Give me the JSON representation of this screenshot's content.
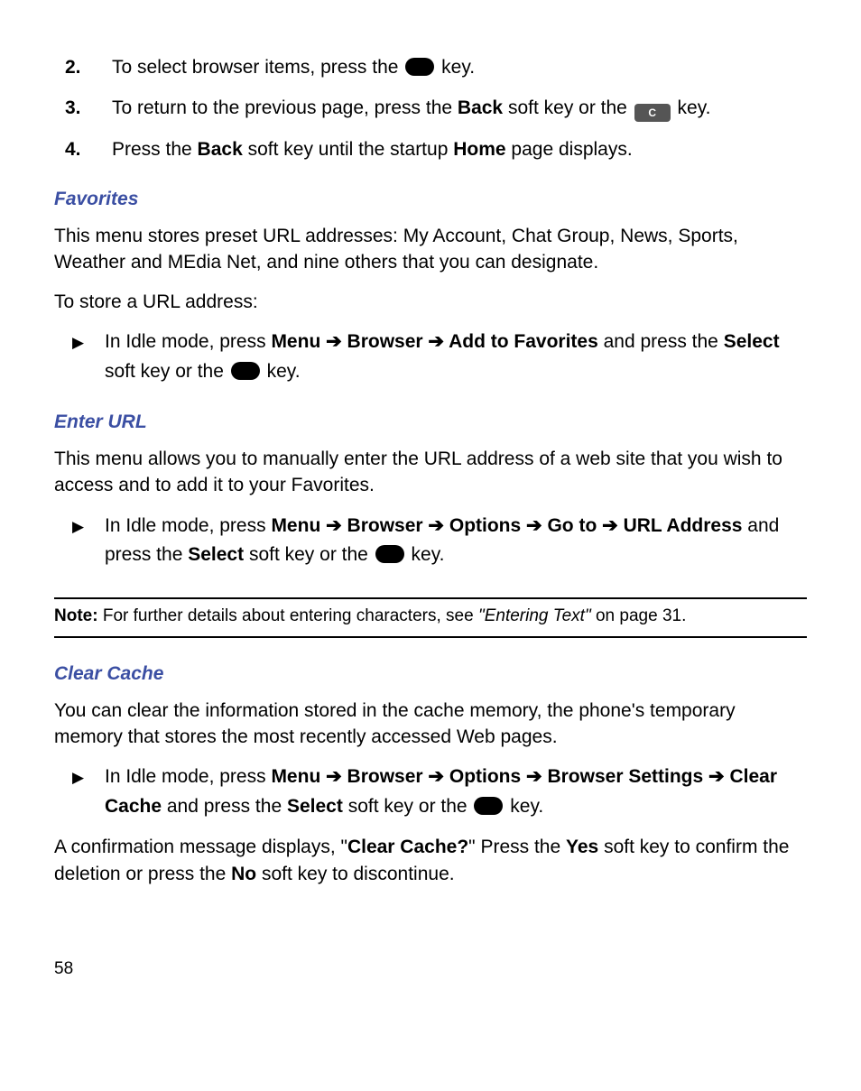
{
  "steps": {
    "s2": {
      "num": "2.",
      "pre": "To select browser items, press the ",
      "post": " key."
    },
    "s3": {
      "num": "3.",
      "pre": "To return to the previous page, press the ",
      "back": "Back",
      "mid": " soft key or the ",
      "post": " key."
    },
    "s4": {
      "num": "4.",
      "pre": "Press the ",
      "back": "Back",
      "mid": " soft key until the startup ",
      "home": "Home",
      "post": " page displays."
    }
  },
  "favorites": {
    "heading": "Favorites",
    "p1": "This menu stores preset URL addresses: My Account, Chat Group, News, Sports, Weather and MEdia Net, and nine others that you can designate.",
    "p2": "To store a URL address:",
    "bullet": {
      "pre": "In Idle mode, press ",
      "menu": "Menu",
      "browser": "Browser",
      "add": "Add to Favorites",
      "mid1": " and press the ",
      "select": "Select",
      "mid2": " soft key or the ",
      "post": " key."
    }
  },
  "enterurl": {
    "heading": "Enter URL",
    "p1": "This menu allows you to manually enter the URL address of a web site that you wish to access and to add it to your Favorites.",
    "bullet": {
      "pre": "In Idle mode, press ",
      "menu": "Menu",
      "browser": "Browser",
      "options": "Options",
      "goto": "Go to",
      "url": "URL Address",
      "mid1": " and press the ",
      "select": "Select",
      "mid2": " soft key or the ",
      "post": " key."
    }
  },
  "note": {
    "label": "Note:",
    "text1": " For further details about entering characters, see ",
    "ref": "\"Entering Text\"",
    "text2": " on page 31."
  },
  "clearcache": {
    "heading": "Clear Cache",
    "p1": "You can clear the information stored in the cache memory, the phone's temporary memory that stores the most recently accessed Web pages.",
    "bullet": {
      "pre": "In Idle mode, press ",
      "menu": "Menu",
      "browser": "Browser",
      "options": "Options",
      "bsettings": "Browser Settings",
      "cc": "Clear Cache",
      "mid1": " and press the ",
      "select": "Select",
      "mid2": " soft key or the ",
      "post": " key."
    },
    "p2a": "A confirmation message displays, \"",
    "p2b": "Clear Cache?",
    "p2c": "\" Press the ",
    "yes": "Yes",
    "p2d": " soft key to confirm the deletion or press the ",
    "no": "No",
    "p2e": " soft key to discontinue."
  },
  "arrow": " ➔ ",
  "c_key_label": "C",
  "pagenum": "58"
}
